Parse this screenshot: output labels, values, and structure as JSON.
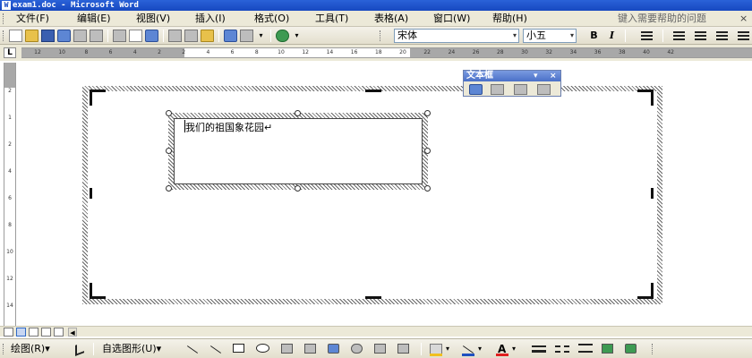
{
  "window": {
    "title": "exam1.doc - Microsoft Word",
    "app_icon": "W"
  },
  "menubar": {
    "items": [
      {
        "label": "文件(F)"
      },
      {
        "label": "编辑(E)"
      },
      {
        "label": "视图(V)"
      },
      {
        "label": "插入(I)"
      },
      {
        "label": "格式(O)"
      },
      {
        "label": "工具(T)"
      },
      {
        "label": "表格(A)"
      },
      {
        "label": "窗口(W)"
      },
      {
        "label": "帮助(H)"
      }
    ],
    "help_placeholder": "键入需要帮助的问题",
    "close_glyph": "×"
  },
  "toolbar": {
    "font_name": "宋体",
    "font_size": "小五",
    "bold_label": "B",
    "italic_label": "I",
    "dropdown_arrow": "▾"
  },
  "ruler": {
    "corner_label": "L",
    "ticks": [
      "12",
      "10",
      "8",
      "6",
      "4",
      "2",
      "2",
      "4",
      "6",
      "8",
      "10",
      "12",
      "14",
      "16",
      "18",
      "20",
      "22",
      "24",
      "26",
      "28",
      "30",
      "32",
      "34",
      "36",
      "38",
      "40",
      "42"
    ]
  },
  "vruler": {
    "ticks": [
      "2",
      "1",
      "2",
      "4",
      "6",
      "8",
      "10",
      "12",
      "14"
    ]
  },
  "textbox_toolbar": {
    "title": "文本框",
    "menu_glyph": "▾",
    "close_glyph": "×"
  },
  "document": {
    "inner_text": "我们的祖国象花园↵"
  },
  "drawbar": {
    "draw_label": "绘图(R)▾",
    "autoshapes_label": "自选图形(U)▾",
    "font_color_label": "A"
  },
  "colors": {
    "title_bar": "#1748c0",
    "chrome": "#ece9d8",
    "fill_yellow": "#f0c020",
    "line_blue": "#2050c0",
    "font_red": "#e02020"
  }
}
